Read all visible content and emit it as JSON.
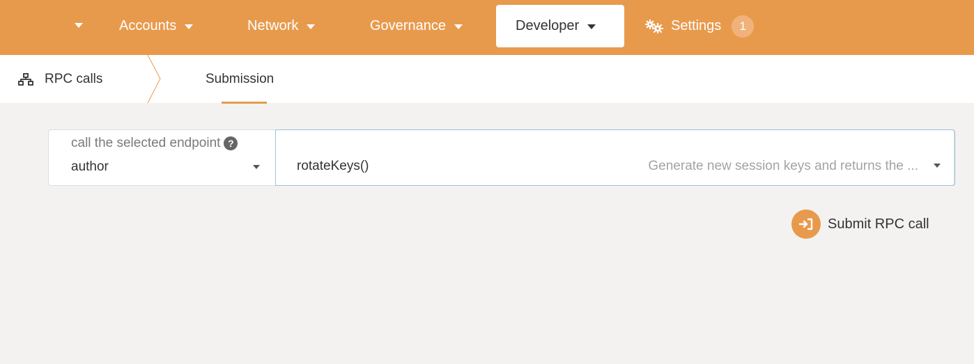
{
  "nav": {
    "items": [
      {
        "label": "Accounts"
      },
      {
        "label": "Network"
      },
      {
        "label": "Governance"
      },
      {
        "label": "Developer"
      },
      {
        "label": "Settings",
        "badge": "1"
      }
    ],
    "accent": "#e89a4c"
  },
  "subnav": {
    "section": "RPC calls",
    "tab": "Submission"
  },
  "form": {
    "label": "call the selected endpoint",
    "section_value": "author",
    "method_value": "rotateKeys()",
    "method_description": "Generate new session keys and returns the ..."
  },
  "actions": {
    "submit_label": "Submit RPC call"
  },
  "icons": [
    "chevron-down-icon",
    "gears-icon",
    "network-icon",
    "help-icon",
    "sign-in-icon"
  ]
}
